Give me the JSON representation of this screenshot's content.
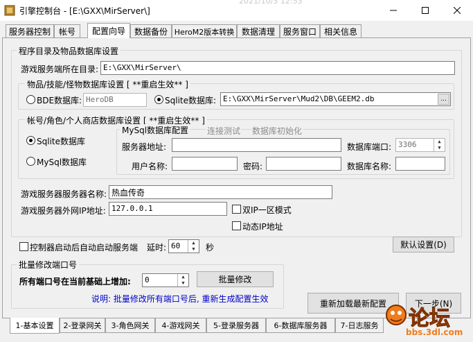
{
  "window": {
    "title": "引擎控制台 - [E:\\GXX\\MirServer\\]",
    "timestamp": "2021/10/3 12:53"
  },
  "tabs": [
    "服务器控制",
    "帐号",
    "配置向导",
    "数据备份",
    "HeroM2版本转换",
    "数据清理",
    "服务窗口",
    "相关信息"
  ],
  "active_tab": 2,
  "program_section": {
    "legend": "程序目录及物品数据库设置",
    "server_dir_label": "游戏服务端所在目录:",
    "server_dir_value": "E:\\GXX\\MirServer\\",
    "item_db": {
      "legend": "物品/技能/怪物数据库设置 [ **重启生效** ]",
      "bde_label": "BDE数据库:",
      "bde_value": "HeroDB",
      "sqlite_label": "Sqlite数据库:",
      "sqlite_value": "E:\\GXX\\MirServer\\Mud2\\DB\\GEEM2.db",
      "browse_label": "...",
      "selected": "sqlite"
    },
    "account_db": {
      "legend": "帐号/角色/个人商店数据库设置  [ **重启生效** ]",
      "sqlite_label": "Sqlite数据库",
      "mysql_label": "MySql数据库",
      "selected": "sqlite",
      "mysql_config": {
        "legend": "MySql数据库配置",
        "test_link": "连接测试",
        "init_link": "数据库初始化",
        "host_label": "服务器地址:",
        "host_value": "",
        "port_label": "数据库端口:",
        "port_value": "3306",
        "user_label": "用户名称:",
        "user_value": "",
        "password_label": "密码:",
        "password_value": "",
        "dbname_label": "数据库名称:",
        "dbname_value": ""
      }
    },
    "server_name_label": "游戏服务器服务器名称:",
    "server_name_value": "热血传奇",
    "server_ip_label": "游戏服务器外网IP地址:",
    "server_ip_value": "127.0.0.1",
    "dual_ip_label": "双IP一区模式",
    "dynamic_ip_label": "动态IP地址",
    "dual_ip_checked": false,
    "dynamic_ip_checked": false
  },
  "auto_start": {
    "label": "控制器启动后自动启动服务端",
    "checked": false,
    "delay_label": "延时:",
    "delay_value": "60",
    "delay_unit": "秒"
  },
  "default_button": "默认设置(D)",
  "port_batch": {
    "legend": "批量修改端口号",
    "label": "所有端口号在当前基础上增加:",
    "value": "0",
    "button": "批量修改",
    "note": "说明: 批量修改所有端口号后, 重新生成配置生效"
  },
  "reload_button": "重新加载最新配置",
  "next_button": "下一步(N)",
  "bottom_tabs": [
    "1-基本设置",
    "2-登录网关",
    "3-角色网关",
    "4-游戏网关",
    "5-登录服务器",
    "6-数据库服务器",
    "7-日志服务"
  ],
  "watermark": {
    "text": "论坛",
    "url": "bbs.3dl.com"
  },
  "colors": {
    "note_blue": "#0000c8",
    "link_gray": "#8c8c8c",
    "watermark_orange": "#f07c1c"
  }
}
